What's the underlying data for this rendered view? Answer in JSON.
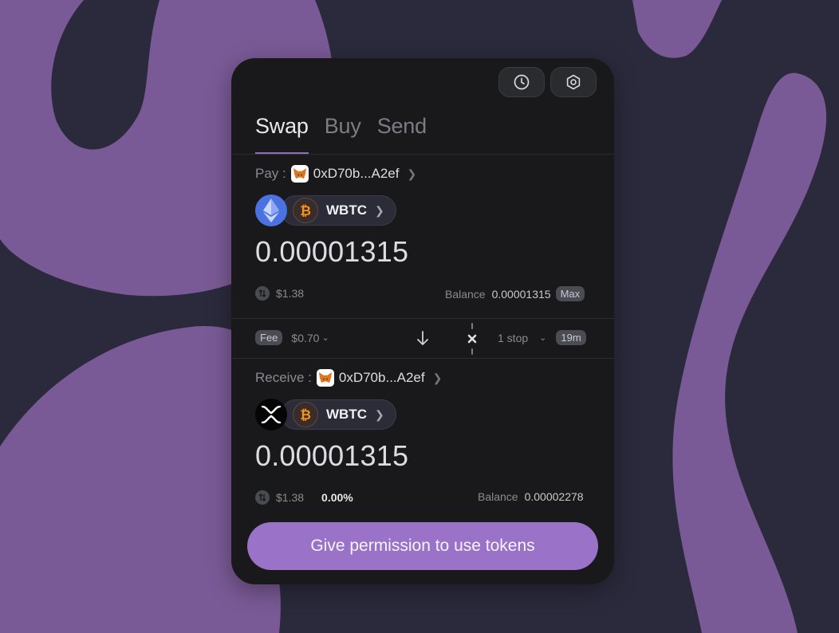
{
  "colors": {
    "background": "#2b2a3c",
    "blob": "#7a5a96",
    "card": "#19191b",
    "accent": "#9a73c9"
  },
  "header": {
    "history_icon": "clock-icon",
    "settings_icon": "gear-icon"
  },
  "tabs": [
    {
      "label": "Swap"
    },
    {
      "label": "Buy"
    },
    {
      "label": "Send"
    }
  ],
  "active_tab": "Swap",
  "pay": {
    "label": "Pay :",
    "address": "0xD70b...A2ef",
    "chain_icon": "ethereum-icon",
    "token_icon": "bitcoin-icon",
    "token": "WBTC",
    "amount": "0.00001315",
    "usd_value": "$1.38",
    "balance_label": "Balance",
    "balance": "0.00001315",
    "max_label": "Max"
  },
  "route": {
    "fee_label": "Fee",
    "fee_value": "$0.70",
    "stops": "1 stop",
    "time": "19m"
  },
  "receive": {
    "label": "Receive :",
    "address": "0xD70b...A2ef",
    "chain_icon": "xrp-icon",
    "token_icon": "bitcoin-icon",
    "token": "WBTC",
    "amount": "0.00001315",
    "usd_value": "$1.38",
    "price_impact": "0.00%",
    "balance_label": "Balance",
    "balance": "0.00002278"
  },
  "action": {
    "label": "Give permission to use tokens"
  }
}
